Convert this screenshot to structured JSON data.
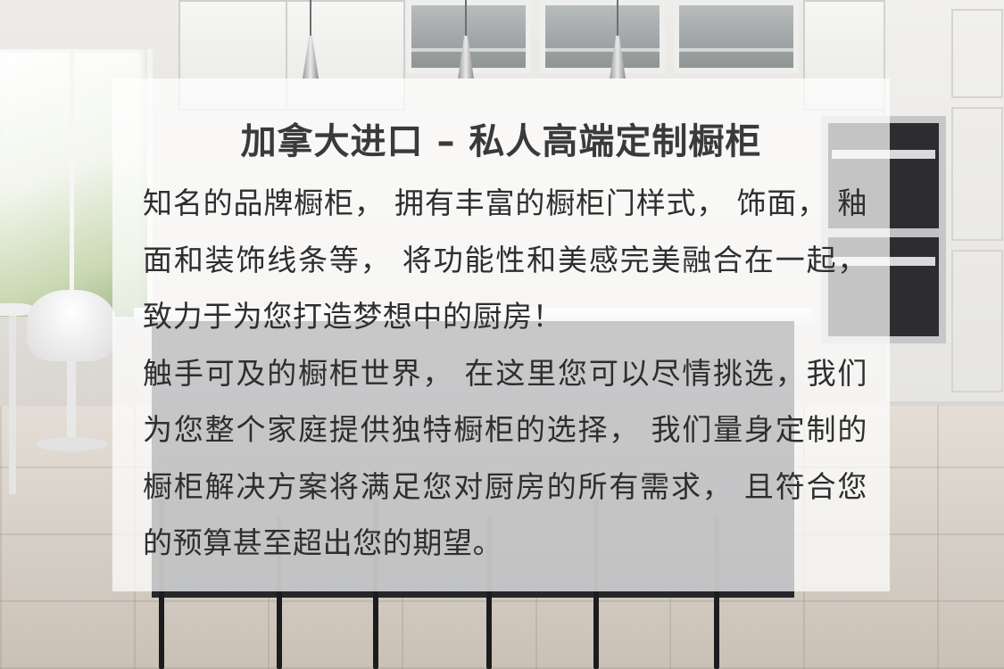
{
  "panel": {
    "title": "加拿大进口 – 私人高端定制橱柜",
    "paragraphs": [
      "知名的品牌橱柜， 拥有丰富的橱柜门样式， 饰面， 釉面和装饰线条等， 将功能性和美感完美融合在一起， 致力于为您打造梦想中的厨房！",
      "触手可及的橱柜世界， 在这里您可以尽情挑选，我们为您整个家庭提供独特橱柜的选择， 我们量身定制的橱柜解决方案将满足您对厨房的所有需求， 且符合您的预算甚至超出您的期望。"
    ]
  },
  "colors": {
    "panel_background": "rgba(255,255,255,0.72)",
    "title_text": "#3a3a3a",
    "body_text": "#2e2e2e"
  }
}
